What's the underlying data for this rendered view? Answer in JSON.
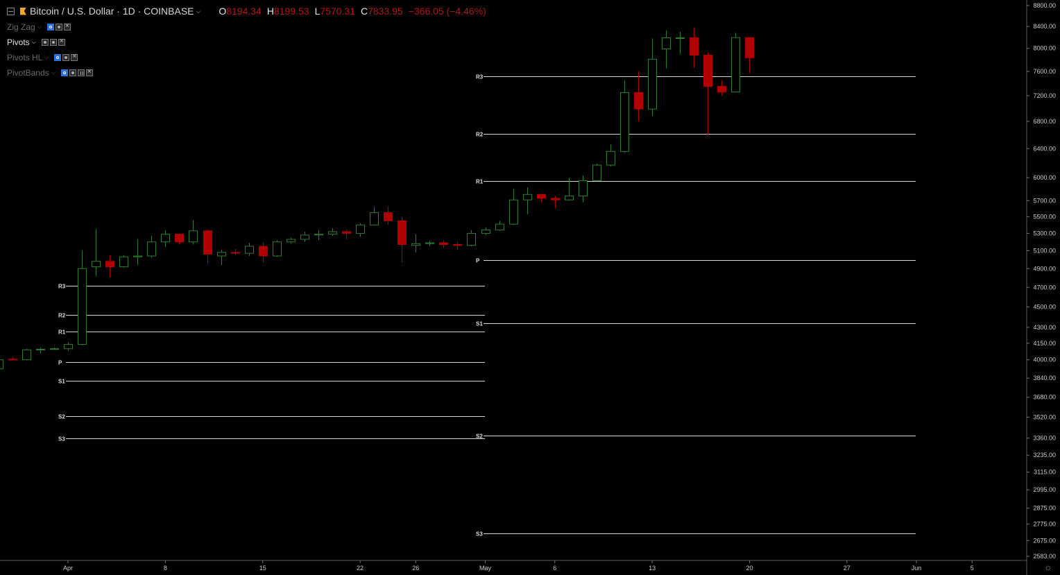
{
  "symbol": {
    "title": "Bitcoin / U.S. Dollar · 1D · COINBASE",
    "ohlc": [
      {
        "label": "O",
        "value": "8194.34"
      },
      {
        "label": "H",
        "value": "8199.53"
      },
      {
        "label": "L",
        "value": "7570.31"
      },
      {
        "label": "C",
        "value": "7833.95"
      }
    ],
    "change": "−366.05 (−4.46%)"
  },
  "indicators": [
    {
      "name": "Zig Zag",
      "active": false,
      "buttons": [
        "visibility-icon",
        "settings-icon",
        "close-icon"
      ]
    },
    {
      "name": "Pivots",
      "active": true,
      "buttons": [
        "visibility-icon",
        "settings-icon",
        "close-icon"
      ]
    },
    {
      "name": "Pivots HL",
      "active": false,
      "buttons": [
        "visibility-icon",
        "settings-icon",
        "close-icon"
      ]
    },
    {
      "name": "PivotBands",
      "active": false,
      "buttons": [
        "visibility-icon",
        "settings-icon",
        "source-icon",
        "close-icon"
      ]
    }
  ],
  "colors": {
    "background": "#000000",
    "up_candle": "#2e7d32",
    "down_candle": "#b00000",
    "pivot_line": "#d8d8d8",
    "axis_text": "#cfcfcf",
    "change_text": "#b01818"
  },
  "chart_data": {
    "type": "candlestick",
    "y_scale": "log",
    "y_ticks": [
      "8800.00",
      "8400.00",
      "8000.00",
      "7600.00",
      "7200.00",
      "6800.00",
      "6400.00",
      "6000.00",
      "5700.00",
      "5500.00",
      "5300.00",
      "5100.00",
      "4900.00",
      "4700.00",
      "4500.00",
      "4300.00",
      "4150.00",
      "4000.00",
      "3840.00",
      "3680.00",
      "3520.00",
      "3360.00",
      "3235.00",
      "3115.00",
      "2995.00",
      "2875.00",
      "2775.00",
      "2675.00",
      "2583.00"
    ],
    "x_ticks": [
      "Apr",
      "8",
      "15",
      "22",
      "26",
      "May",
      "6",
      "13",
      "20",
      "27",
      "Jun",
      "5"
    ],
    "x_tick_dates": [
      "2019-04-01",
      "2019-04-08",
      "2019-04-15",
      "2019-04-22",
      "2019-04-26",
      "2019-05-01",
      "2019-05-06",
      "2019-05-13",
      "2019-05-20",
      "2019-05-27",
      "2019-06-01",
      "2019-06-05"
    ],
    "candles": [
      {
        "d": "2019-03-27",
        "o": 3920,
        "h": 4020,
        "l": 3910,
        "c": 4000
      },
      {
        "d": "2019-03-28",
        "o": 4005,
        "h": 4020,
        "l": 3995,
        "c": 4000
      },
      {
        "d": "2019-03-29",
        "o": 4000,
        "h": 4100,
        "l": 3995,
        "c": 4090
      },
      {
        "d": "2019-03-30",
        "o": 4090,
        "h": 4110,
        "l": 4060,
        "c": 4095
      },
      {
        "d": "2019-03-31",
        "o": 4095,
        "h": 4110,
        "l": 4090,
        "c": 4100
      },
      {
        "d": "2019-04-01",
        "o": 4100,
        "h": 4160,
        "l": 4080,
        "c": 4140
      },
      {
        "d": "2019-04-02",
        "o": 4140,
        "h": 5100,
        "l": 4130,
        "c": 4900
      },
      {
        "d": "2019-04-03",
        "o": 4920,
        "h": 5350,
        "l": 4820,
        "c": 4980
      },
      {
        "d": "2019-04-04",
        "o": 4980,
        "h": 5050,
        "l": 4800,
        "c": 4920
      },
      {
        "d": "2019-04-05",
        "o": 4920,
        "h": 5050,
        "l": 4910,
        "c": 5030
      },
      {
        "d": "2019-04-06",
        "o": 5030,
        "h": 5230,
        "l": 4940,
        "c": 5040
      },
      {
        "d": "2019-04-07",
        "o": 5040,
        "h": 5270,
        "l": 5020,
        "c": 5200
      },
      {
        "d": "2019-04-08",
        "o": 5200,
        "h": 5340,
        "l": 5140,
        "c": 5290
      },
      {
        "d": "2019-04-09",
        "o": 5290,
        "h": 5300,
        "l": 5170,
        "c": 5200
      },
      {
        "d": "2019-04-10",
        "o": 5200,
        "h": 5460,
        "l": 5170,
        "c": 5330
      },
      {
        "d": "2019-04-11",
        "o": 5330,
        "h": 5340,
        "l": 4950,
        "c": 5060
      },
      {
        "d": "2019-04-12",
        "o": 5040,
        "h": 5110,
        "l": 4940,
        "c": 5080
      },
      {
        "d": "2019-04-13",
        "o": 5080,
        "h": 5120,
        "l": 5050,
        "c": 5070
      },
      {
        "d": "2019-04-14",
        "o": 5070,
        "h": 5190,
        "l": 5040,
        "c": 5150
      },
      {
        "d": "2019-04-15",
        "o": 5150,
        "h": 5190,
        "l": 4970,
        "c": 5040
      },
      {
        "d": "2019-04-16",
        "o": 5040,
        "h": 5220,
        "l": 5030,
        "c": 5200
      },
      {
        "d": "2019-04-17",
        "o": 5200,
        "h": 5250,
        "l": 5180,
        "c": 5230
      },
      {
        "d": "2019-04-18",
        "o": 5230,
        "h": 5320,
        "l": 5200,
        "c": 5280
      },
      {
        "d": "2019-04-19",
        "o": 5280,
        "h": 5340,
        "l": 5220,
        "c": 5290
      },
      {
        "d": "2019-04-20",
        "o": 5290,
        "h": 5360,
        "l": 5270,
        "c": 5320
      },
      {
        "d": "2019-04-21",
        "o": 5320,
        "h": 5340,
        "l": 5230,
        "c": 5300
      },
      {
        "d": "2019-04-22",
        "o": 5300,
        "h": 5420,
        "l": 5260,
        "c": 5400
      },
      {
        "d": "2019-04-23",
        "o": 5400,
        "h": 5620,
        "l": 5390,
        "c": 5550
      },
      {
        "d": "2019-04-24",
        "o": 5550,
        "h": 5630,
        "l": 5400,
        "c": 5450
      },
      {
        "d": "2019-04-25",
        "o": 5450,
        "h": 5500,
        "l": 4970,
        "c": 5170
      },
      {
        "d": "2019-04-26",
        "o": 5160,
        "h": 5290,
        "l": 5080,
        "c": 5180
      },
      {
        "d": "2019-04-27",
        "o": 5180,
        "h": 5210,
        "l": 5150,
        "c": 5190
      },
      {
        "d": "2019-04-28",
        "o": 5190,
        "h": 5220,
        "l": 5130,
        "c": 5170
      },
      {
        "d": "2019-04-29",
        "o": 5170,
        "h": 5200,
        "l": 5110,
        "c": 5160
      },
      {
        "d": "2019-04-30",
        "o": 5160,
        "h": 5340,
        "l": 5150,
        "c": 5300
      },
      {
        "d": "2019-05-01",
        "o": 5300,
        "h": 5370,
        "l": 5280,
        "c": 5340
      },
      {
        "d": "2019-05-02",
        "o": 5340,
        "h": 5450,
        "l": 5330,
        "c": 5410
      },
      {
        "d": "2019-05-03",
        "o": 5410,
        "h": 5850,
        "l": 5400,
        "c": 5710
      },
      {
        "d": "2019-05-04",
        "o": 5710,
        "h": 5870,
        "l": 5530,
        "c": 5780
      },
      {
        "d": "2019-05-05",
        "o": 5780,
        "h": 5790,
        "l": 5680,
        "c": 5730
      },
      {
        "d": "2019-05-06",
        "o": 5730,
        "h": 5760,
        "l": 5600,
        "c": 5710
      },
      {
        "d": "2019-05-07",
        "o": 5710,
        "h": 6000,
        "l": 5700,
        "c": 5760
      },
      {
        "d": "2019-05-08",
        "o": 5760,
        "h": 6030,
        "l": 5680,
        "c": 5960
      },
      {
        "d": "2019-05-09",
        "o": 5960,
        "h": 6190,
        "l": 5950,
        "c": 6170
      },
      {
        "d": "2019-05-10",
        "o": 6170,
        "h": 6460,
        "l": 6150,
        "c": 6360
      },
      {
        "d": "2019-05-11",
        "o": 6360,
        "h": 7450,
        "l": 6340,
        "c": 7250
      },
      {
        "d": "2019-05-12",
        "o": 7250,
        "h": 7600,
        "l": 6800,
        "c": 6990
      },
      {
        "d": "2019-05-13",
        "o": 6990,
        "h": 8180,
        "l": 6880,
        "c": 7810
      },
      {
        "d": "2019-05-14",
        "o": 7990,
        "h": 8330,
        "l": 7650,
        "c": 8190
      },
      {
        "d": "2019-05-15",
        "o": 8190,
        "h": 8300,
        "l": 7900,
        "c": 8190
      },
      {
        "d": "2019-05-16",
        "o": 8190,
        "h": 8370,
        "l": 7660,
        "c": 7880
      },
      {
        "d": "2019-05-17",
        "o": 7880,
        "h": 7930,
        "l": 6600,
        "c": 7350
      },
      {
        "d": "2019-05-18",
        "o": 7350,
        "h": 7450,
        "l": 7200,
        "c": 7260
      },
      {
        "d": "2019-05-19",
        "o": 7260,
        "h": 8280,
        "l": 7250,
        "c": 8194.34
      },
      {
        "d": "2019-05-20",
        "o": 8194.34,
        "h": 8199.53,
        "l": 7570.31,
        "c": 7833.95
      }
    ],
    "pivots": [
      {
        "period": "2019-04",
        "levels": [
          {
            "label": "R3",
            "value": 4720
          },
          {
            "label": "R2",
            "value": 4420
          },
          {
            "label": "R1",
            "value": 4260
          },
          {
            "label": "P",
            "value": 3980
          },
          {
            "label": "S1",
            "value": 3820
          },
          {
            "label": "S2",
            "value": 3530
          },
          {
            "label": "S3",
            "value": 3360
          }
        ]
      },
      {
        "period": "2019-05",
        "levels": [
          {
            "label": "R3",
            "value": 7520
          },
          {
            "label": "R2",
            "value": 6610
          },
          {
            "label": "R1",
            "value": 5950
          },
          {
            "label": "P",
            "value": 4990
          },
          {
            "label": "S1",
            "value": 4340
          },
          {
            "label": "S2",
            "value": 3380
          },
          {
            "label": "S3",
            "value": 2720
          }
        ]
      }
    ]
  }
}
